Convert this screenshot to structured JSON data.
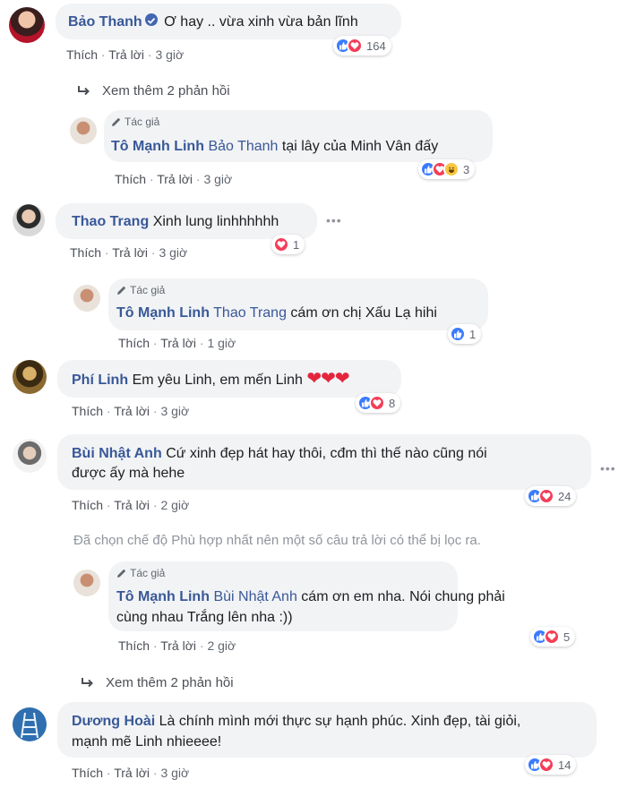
{
  "comments": [
    {
      "name": "Bảo Thanh",
      "text": "Ơ hay .. vừa xinh vừa bản lĩnh",
      "actions": {
        "like": "Thích",
        "reply": "Trả lời",
        "time": "3 giờ"
      },
      "reactions": {
        "types": [
          "like",
          "love"
        ],
        "count": "164"
      }
    },
    {
      "name": "Thao Trang",
      "text": "Xinh lung linhhhhhh",
      "actions": {
        "like": "Thích",
        "reply": "Trả lời",
        "time": "3 giờ"
      },
      "reactions": {
        "types": [
          "love"
        ],
        "count": "1"
      }
    },
    {
      "name": "Phí Linh",
      "text": "Em yêu Linh, em mến Linh",
      "emoji": "❤❤❤",
      "actions": {
        "like": "Thích",
        "reply": "Trả lời",
        "time": "3 giờ"
      },
      "reactions": {
        "types": [
          "like",
          "love"
        ],
        "count": "8"
      }
    },
    {
      "name": "Bùi Nhật Anh",
      "text_line1": "Cứ xinh đẹp hát hay thôi, cđm thì thế nào cũng nói",
      "text_line2": "được ấy mà hehe",
      "actions": {
        "like": "Thích",
        "reply": "Trả lời",
        "time": "2 giờ"
      },
      "reactions": {
        "types": [
          "like",
          "love"
        ],
        "count": "24"
      }
    },
    {
      "name": "Dương Hoài",
      "text_line1": "Là chính mình mới thực sự hạnh phúc. Xinh đẹp, tài giỏi,",
      "text_line2": "mạnh mẽ Linh nhieeee!",
      "actions": {
        "like": "Thích",
        "reply": "Trả lời",
        "time": "3 giờ"
      },
      "reactions": {
        "types": [
          "like",
          "love"
        ],
        "count": "14"
      }
    }
  ],
  "replies": [
    {
      "author_tag": "Tác giả",
      "name": "Tô Mạnh Linh",
      "mention": "Bảo Thanh",
      "text": "tại lây của Minh Vân đấy",
      "actions": {
        "like": "Thích",
        "reply": "Trả lời",
        "time": "3 giờ"
      },
      "reactions": {
        "types": [
          "like",
          "love",
          "haha"
        ],
        "count": "3"
      }
    },
    {
      "author_tag": "Tác giả",
      "name": "Tô Mạnh Linh",
      "mention": "Thao Trang",
      "text": "cám ơn chị Xấu Lạ hihi",
      "actions": {
        "like": "Thích",
        "reply": "Trả lời",
        "time": "1 giờ"
      },
      "reactions": {
        "types": [
          "like"
        ],
        "count": "1"
      }
    },
    {
      "author_tag": "Tác giả",
      "name": "Tô Mạnh Linh",
      "mention": "Bùi Nhật Anh",
      "text_line1": "cám ơn em nha. Nói chung phải",
      "text_line2": "cùng nhau Trắng lên nha :))",
      "actions": {
        "like": "Thích",
        "reply": "Trả lời",
        "time": "2 giờ"
      },
      "reactions": {
        "types": [
          "like",
          "love"
        ],
        "count": "5"
      }
    }
  ],
  "more_replies": [
    "Xem thêm 2 phản hồi",
    "Xem thêm 2 phản hồi"
  ],
  "filter_note": "Đã chọn chế độ Phù hợp nhất nên một số câu trả lời có thể bị lọc ra.",
  "colors": {
    "name": "#385898",
    "bubble": "#f2f3f5",
    "like": "#3b7bff",
    "love": "#f33e58",
    "haha": "#f7c741"
  },
  "icons": {
    "more_replies": "reply-arrow-icon",
    "author": "pencil-icon",
    "options": "ellipsis-icon",
    "verified": "verified-badge-icon"
  }
}
